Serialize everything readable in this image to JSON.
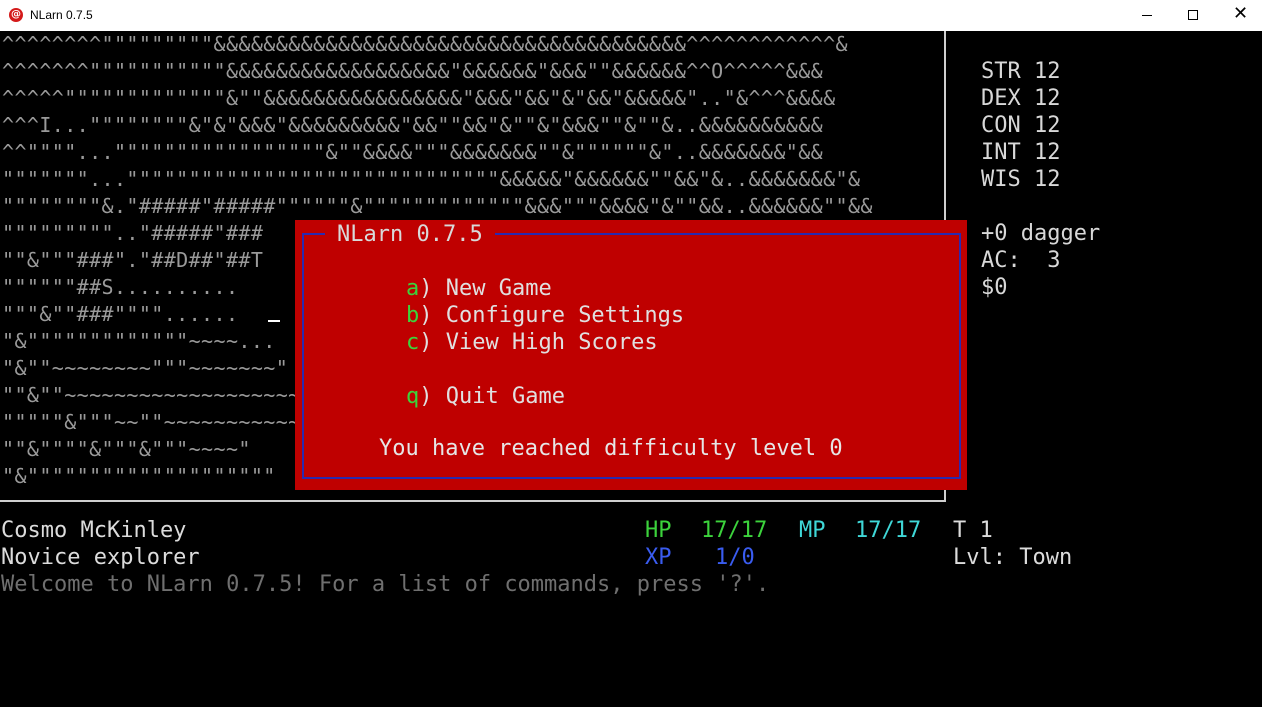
{
  "window": {
    "title": "NLarn 0.7.5",
    "icon_glyph": "@",
    "close_glyph": "✕"
  },
  "map": {
    "rows": [
      "^^^^^^^^\"\"\"\"\"\"\"\"\"&&&&&&&&&&&&&&&&&&&&&&&&&&&&&&&&&&&&&&^^^^^^^^^^^^&",
      "^^^^^^^\"\"\"\"\"\"\"\"\"\"\"&&&&&&&&&&&&&&&&&&\"&&&&&&\"&&&\"\"&&&&&&^^O^^^^^&&&",
      "^^^^^\"\"\"\"\"\"\"\"\"\"\"\"\"&\"\"&&&&&&&&&&&&&&&&\"&&&\"&&\"&\"&&\"&&&&&\"..\"&^^^&&&&",
      "^^^I...\"\"\"\"\"\"\"\"&\"&\"&&&\"&&&&&&&&&\"&&\"\"&&\"&\"\"&\"&&&\"\"&\"\"&..&&&&&&&&&&",
      "^^\"\"\"\"...\"\"\"\"\"\"\"\"\"\"\"\"\"\"\"\"\"&\"\"&&&&\"\"\"&&&&&&&\"\"&\"\"\"\"\"\"&\"..&&&&&&&\"&&",
      "\"\"\"\"\"\"\"...\"\"\"\"\"\"\"\"\"\"\"\"\"\"\"\"\"\"\"\"\"\"\"\"\"\"\"\"\"\"&&&&&\"&&&&&&\"\"&&\"&..&&&&&&&\"&",
      "\"\"\"\"\"\"\"\"&.\"#####\"#####\"\"\"\"\"\"&\"\"\"\"\"\"\"\"\"\"\"\"\"&&&\"\"\"&&&&\"&\"\"&&..&&&&&&\"\"&&",
      "\"\"\"\"\"\"\"\"\"..\"#####\"###",
      "\"\"&\"\"\"###\".\"##D##\"##T",
      "\"\"\"\"\"\"##S..........",
      "\"\"\"&\"\"###\"\"\"\"......",
      "\"&\"\"\"\"\"\"\"\"\"\"\"\"\"~~~~...",
      "\"&\"\"~~~~~~~~\"\"\"~~~~~~~\"",
      "\"\"&\"\"~~~~~~~~~~~~~~~~~~~",
      "\"\"\"\"\"&\"\"\"~~\"\"~~~~~~~~~~~~",
      "\"\"&\"\"\"\"&\"\"\"&\"\"\"~~~~\"",
      "\"&\"\"\"\"\"\"\"\"\"\"\"\"\"\"\"\"\"\"\"\""
    ]
  },
  "stats": {
    "str": "STR 12",
    "dex": "DEX 12",
    "con": "CON 12",
    "int": "INT 12",
    "wis": "WIS 12",
    "weapon": "+0 dagger",
    "ac": "AC:  3",
    "gold": "$0"
  },
  "dialog": {
    "title": "NLarn 0.7.5",
    "items": [
      {
        "key": "a",
        "label": ") New Game"
      },
      {
        "key": "b",
        "label": ") Configure Settings"
      },
      {
        "key": "c",
        "label": ") View High Scores"
      },
      {
        "key": "q",
        "label": ") Quit Game"
      }
    ],
    "difficulty": "You have reached difficulty level 0"
  },
  "status": {
    "name": "Cosmo McKinley",
    "rank": "Novice explorer",
    "hp_label": "HP",
    "hp_value": "17/17",
    "mp_label": "MP",
    "mp_value": "17/17",
    "xp_label": "XP",
    "xp_value": "1/0",
    "turn": "T 1",
    "level": "Lvl: Town",
    "message": "Welcome to NLarn 0.7.5! For a list of commands, press '?'."
  },
  "colors": {
    "hp": "#3cd33c",
    "mp": "#3fd7d7",
    "xp": "#3a5cf0",
    "dialog_bg": "#bf0000",
    "menu_key": "#3cd33c"
  }
}
